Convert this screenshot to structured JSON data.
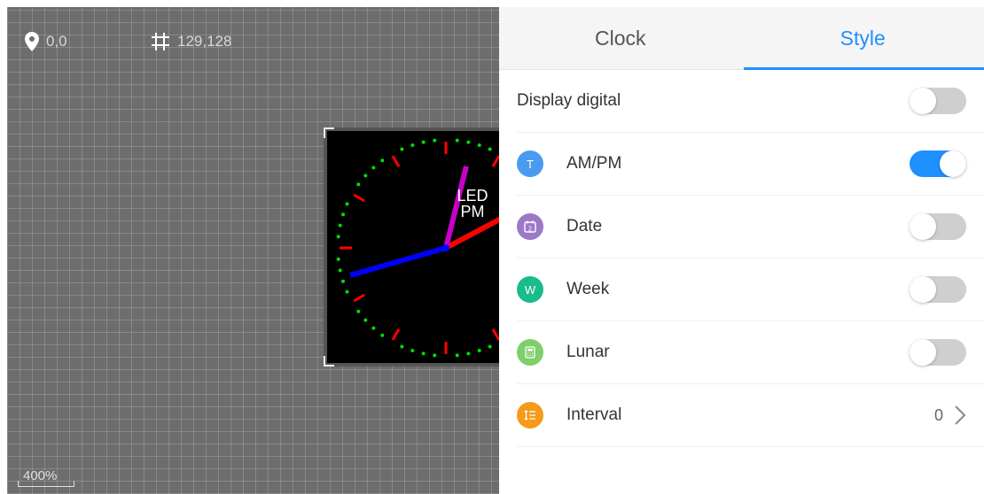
{
  "canvas": {
    "position_readout": "0,0",
    "size_readout": "129,128",
    "zoom": "400%",
    "clock_text_line1": "LED",
    "clock_text_line2": "PM"
  },
  "tabs": [
    {
      "label": "Clock",
      "active": false
    },
    {
      "label": "Style",
      "active": true
    }
  ],
  "settings": {
    "display_digital": {
      "label": "Display digital",
      "enabled": false
    },
    "ampm": {
      "label": "AM/PM",
      "icon": "T",
      "icon_color": "#4a9bf0",
      "enabled": true
    },
    "date": {
      "label": "Date",
      "icon": "calendar-icon",
      "icon_color": "#9b78c8",
      "enabled": false
    },
    "week": {
      "label": "Week",
      "icon": "W",
      "icon_color": "#1abc8c",
      "enabled": false
    },
    "lunar": {
      "label": "Lunar",
      "icon": "calculator-icon",
      "icon_color": "#7fcf6b",
      "enabled": false
    },
    "interval": {
      "label": "Interval",
      "icon": "list-icon",
      "icon_color": "#f59b1a",
      "value": "0"
    }
  },
  "colors": {
    "accent": "#1e90ff",
    "hour_hand": "#ff0000",
    "minute_hand": "#c800c8",
    "second_hand": "#0000ff",
    "minute_dots": "#00dd00",
    "hour_marks": "#ff0000"
  }
}
